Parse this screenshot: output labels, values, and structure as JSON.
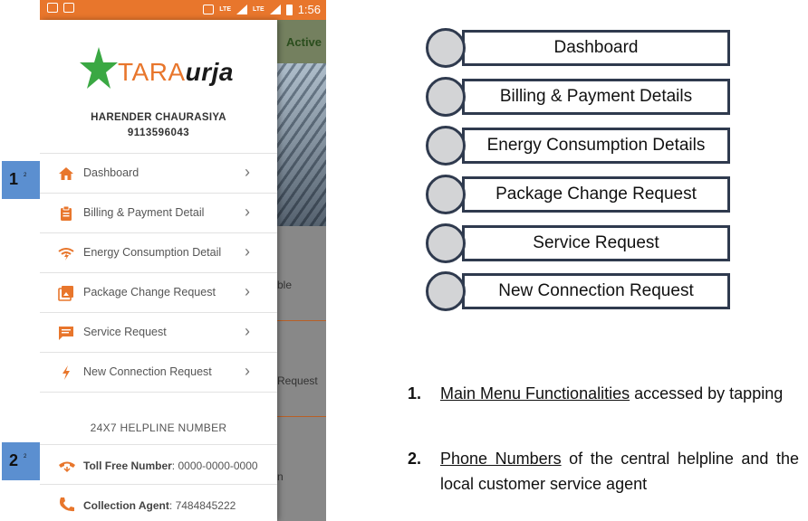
{
  "status_bar": {
    "time": "1:56",
    "lte1": "LTE",
    "lte2": "LTE"
  },
  "background_app": {
    "active": "Active",
    "text1": "ble",
    "text2": "Request",
    "text3": "n"
  },
  "brand": {
    "part1": "TARA",
    "part2": "urja"
  },
  "user": {
    "name": "HARENDER CHAURASIYA",
    "phone": "9113596043"
  },
  "menu": [
    {
      "label": "Dashboard",
      "icon": "home-icon"
    },
    {
      "label": "Billing & Payment Detail",
      "icon": "clipboard-icon"
    },
    {
      "label": "Energy Consumption Detail",
      "icon": "energy-icon"
    },
    {
      "label": "Package Change Request",
      "icon": "image-icon"
    },
    {
      "label": "Service Request",
      "icon": "message-icon"
    },
    {
      "label": "New Connection Request",
      "icon": "bolt-icon"
    }
  ],
  "chevron": "›",
  "helpline": {
    "title": "24X7 HELPLINE NUMBER",
    "contacts": [
      {
        "label": "Toll Free Number",
        "sep": ":",
        "value": " 0000-0000-0000",
        "icon": "phone-hangup-icon"
      },
      {
        "label": "Collection Agent",
        "sep": ":",
        "value": " 7484845222",
        "icon": "phone-icon"
      }
    ]
  },
  "markers": [
    {
      "num": "1",
      "sup": "2"
    },
    {
      "num": "2",
      "sup": "2"
    }
  ],
  "right_boxes": [
    "Dashboard",
    "Billing & Payment Details",
    "Energy Consumption Details",
    "Package Change Request",
    "Service Request",
    "New Connection Request"
  ],
  "notes": [
    {
      "num": "1.",
      "underlined": "Main Menu Functionalities",
      "rest": " accessed by tapping"
    },
    {
      "num": "2.",
      "underlined": "Phone Numbers",
      "rest": " of the central helpline and the local customer service agent"
    }
  ],
  "colors": {
    "accent": "#e8762c",
    "star": "#3aa843",
    "marker": "#5b8fd0",
    "box_border": "#2f3a4e"
  }
}
